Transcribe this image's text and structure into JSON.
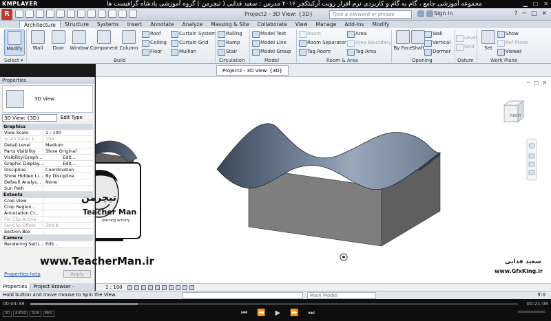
{
  "player": {
    "logo": "KMPLAYER",
    "caption": "مجموعه آموزشی جامع ، گام به گام و کاربردی نرم افزار رویت آرکیتکچر ۲۰۱۶    مدرس : سعید فدایی ( تیچرمن ) گروه آموزشی پادشاه گرافیست ها",
    "window_controls": [
      "▁",
      "□",
      "✕"
    ],
    "time_elapsed": "00:04:38",
    "time_total": "00:21:08",
    "progress": 0.22,
    "controls": [
      "⏮",
      "⏪",
      "▶",
      "⏩",
      "⏭"
    ],
    "tags": [
      "3D",
      "AUDIO",
      "SUB",
      "MKV"
    ]
  },
  "revit": {
    "app_button": "R",
    "doc_title": "Project2 - 3D View: {3D}",
    "search_placeholder": "Type a keyword or phrase",
    "signin": "Sign In",
    "window_controls": [
      "?",
      "─",
      "□",
      "✕"
    ]
  },
  "tabs": [
    "Architecture",
    "Structure",
    "Systems",
    "Insert",
    "Annotate",
    "Analyze",
    "Massing & Site",
    "Collaborate",
    "View",
    "Manage",
    "Add-Ins",
    "Modify"
  ],
  "ribbon": {
    "modify": "Modify",
    "select": "Select ▾",
    "build": "Build",
    "wall": "Wall",
    "door": "Door",
    "window": "Window",
    "component": "Component",
    "column": "Column",
    "roof": "Roof",
    "ceiling": "Ceiling",
    "floor": "Floor",
    "curtain_system": "Curtain System",
    "curtain_grid": "Curtain Grid",
    "mullion": "Mullion",
    "railing": "Railing",
    "ramp": "Ramp",
    "stair": "Stair",
    "circulation": "Circulation",
    "model_text": "Model Text",
    "model_line": "Model Line",
    "model_group": "Model Group",
    "model": "Model",
    "room": "Room",
    "room_separator": "Room Separator",
    "tag_room": "Tag Room",
    "area": "Area",
    "area_boundary": "Area Boundary",
    "tag_area": "Tag Area",
    "room_area": "Room & Area",
    "by_face": "By Face",
    "shaft": "Shaft",
    "op_wall": "Wall",
    "vertical": "Vertical",
    "dormer": "Dormer",
    "opening": "Opening",
    "level": "Level",
    "grid": "Grid",
    "datum": "Datum",
    "set": "Set",
    "show": "Show",
    "ref_plane": "Ref Plane",
    "viewer": "Viewer",
    "work_plane": "Work Plane"
  },
  "properties": {
    "header": "Properties",
    "type_name": "3D View",
    "view_selector": "3D View: {3D}",
    "edit_type": "Edit Type",
    "sections": {
      "graphics": "Graphics",
      "extents": "Extents",
      "camera": "Camera"
    },
    "graphics_rows": [
      {
        "k": "View Scale",
        "v": "1 : 100"
      },
      {
        "k": "Scale Value    1:",
        "v": "100"
      },
      {
        "k": "Detail Level",
        "v": "Medium"
      },
      {
        "k": "Parts Visibility",
        "v": "Show Original"
      },
      {
        "k": "Visibility/Graph...",
        "v": "Edit..."
      },
      {
        "k": "Graphic Display...",
        "v": "Edit..."
      },
      {
        "k": "Discipline",
        "v": "Coordination"
      },
      {
        "k": "Show Hidden Li...",
        "v": "By Discipline"
      },
      {
        "k": "Default Analys...",
        "v": "None"
      },
      {
        "k": "Sun Path",
        "v": ""
      }
    ],
    "extents_rows": [
      {
        "k": "Crop View",
        "v": ""
      },
      {
        "k": "Crop Region...",
        "v": ""
      },
      {
        "k": "Annotation Cr...",
        "v": ""
      },
      {
        "k": "Far Clip Active",
        "v": ""
      },
      {
        "k": "Far Clip Offset",
        "v": "304.8"
      },
      {
        "k": "Section Box",
        "v": ""
      }
    ],
    "camera_rows": [
      {
        "k": "Rendering Setti...",
        "v": "Edit..."
      }
    ],
    "help": "Properties help",
    "apply": "Apply"
  },
  "left_tabs": [
    "Properties",
    "Project Browser - Project2"
  ],
  "viewport": {
    "tab_label": "Project2 - 3D View: {3D}",
    "viewcube_face": "RIGHT",
    "win_controls": [
      "─",
      "□",
      "✕"
    ]
  },
  "view_control": {
    "scale": "1 : 100"
  },
  "status": {
    "message": "Hold button and move mouse to Spin the View.",
    "model": "Main Model",
    "filter": "⊽:0"
  },
  "watermarks": {
    "site": "www.TeacherMan.ir",
    "brand_fa": "تیچرمن",
    "teacher_man": "Teacher Man",
    "learning": "learning activity",
    "gfx": "www.GfxKing.ir",
    "gfx_fa": "سعید فدایی"
  },
  "colors": {
    "roof_dark": "#2e3b4a",
    "roof_light": "#8e9cb0",
    "box_side": "#7f7f7f",
    "box_front": "#5e5e5e",
    "accent": "#6f9bd1"
  }
}
